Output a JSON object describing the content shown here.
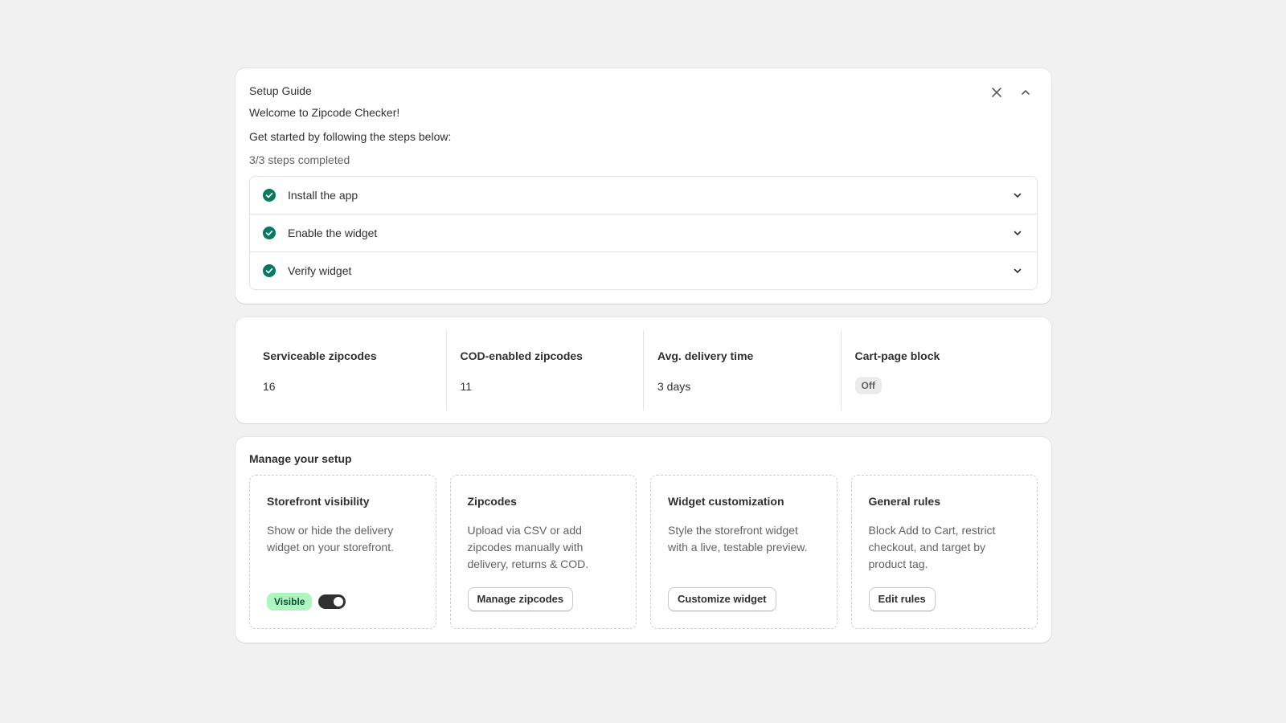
{
  "setup_guide": {
    "title": "Setup Guide",
    "welcome": "Welcome to Zipcode Checker!",
    "subtitle": "Get started by following the steps below:",
    "progress": "3/3 steps completed",
    "steps": [
      {
        "label": "Install the app",
        "completed": true
      },
      {
        "label": "Enable the widget",
        "completed": true
      },
      {
        "label": "Verify widget",
        "completed": true
      }
    ],
    "icons": {
      "close": "close-icon",
      "collapse": "chevron-up-icon"
    }
  },
  "stats": [
    {
      "label": "Serviceable zipcodes",
      "value": "16"
    },
    {
      "label": "COD-enabled zipcodes",
      "value": "11"
    },
    {
      "label": "Avg. delivery time",
      "value": "3 days"
    },
    {
      "label": "Cart-page block",
      "value": "Off"
    }
  ],
  "manage": {
    "title": "Manage your setup",
    "tiles": [
      {
        "title": "Storefront visibility",
        "description": "Show or hide the delivery widget on your storefront.",
        "badge": "Visible",
        "toggle_on": true
      },
      {
        "title": "Zipcodes",
        "description": "Upload via CSV or add zipcodes manually with delivery, returns & COD.",
        "button": "Manage zipcodes"
      },
      {
        "title": "Widget customization",
        "description": "Style the storefront widget with a live, testable preview.",
        "button": "Customize widget"
      },
      {
        "title": "General rules",
        "description": "Block Add to Cart, restrict checkout, and target by product tag.",
        "button": "Edit rules"
      }
    ]
  },
  "colors": {
    "success": "#047b5d",
    "badge_visible_bg": "#aff5c2",
    "badge_off_bg": "#ebebeb",
    "page_bg": "#f1f1f1"
  }
}
